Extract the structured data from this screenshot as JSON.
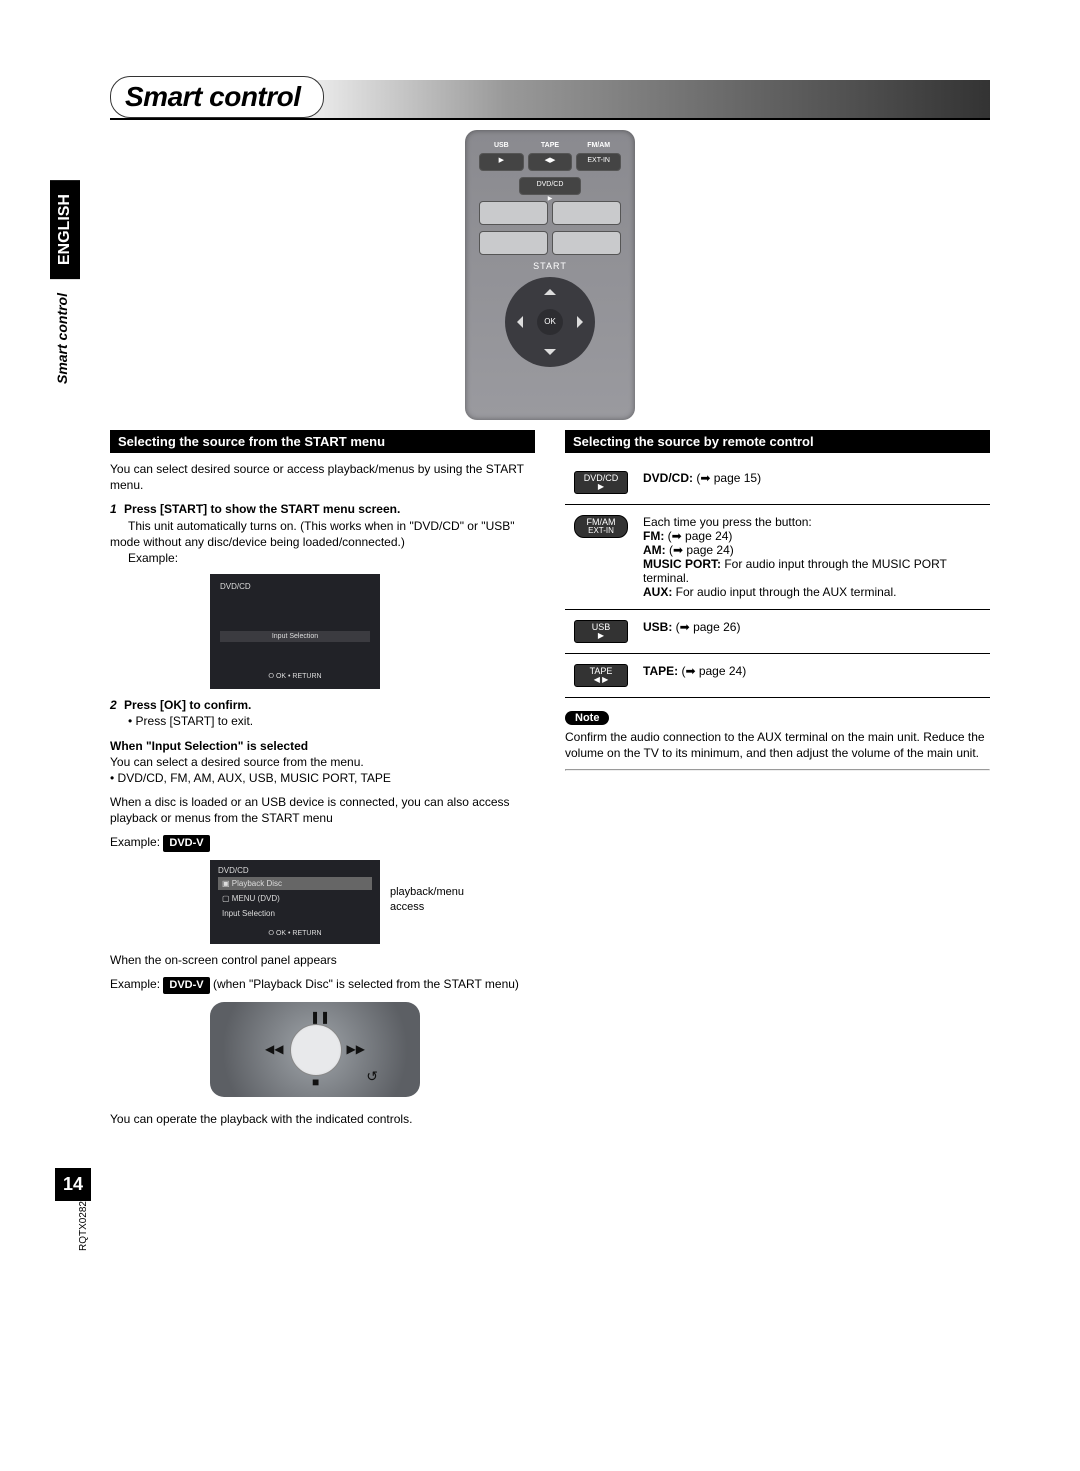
{
  "page": {
    "title": "Smart control",
    "language_tab": "ENGLISH",
    "side_label": "Smart control",
    "doc_code": "RQTX0282",
    "number": "14"
  },
  "remote": {
    "row1_labels": [
      "USB",
      "TAPE",
      "FM/AM"
    ],
    "row1_btn3": "EXT-IN",
    "dvdcd": "DVD/CD",
    "start": "START",
    "ok": "OK"
  },
  "left": {
    "header": "Selecting the source from the START menu",
    "intro": "You can select desired source or access playback/menus by using the START menu.",
    "step1_num": "1",
    "step1_head": "Press [START] to show the START menu screen.",
    "step1_body": "This unit automatically turns on. (This works when in \"DVD/CD\" or \"USB\" mode without any disc/device being loaded/connected.)",
    "example": "Example:",
    "screen1": {
      "title": "DVD/CD",
      "highlight": "Input Selection",
      "return": "OK • RETURN"
    },
    "step2_num": "2",
    "step2_head": "Press [OK] to confirm.",
    "step2_bullet": "Press [START] to exit.",
    "subhead": "When \"Input Selection\" is selected",
    "sub_body1": "You can select a desired source from the menu.",
    "sub_bullet": "DVD/CD, FM, AM, AUX, USB, MUSIC PORT, TAPE",
    "sub_body2": "When a disc is loaded or an USB device is connected, you can also access playback or menus from the START menu",
    "example2_label": "Example:",
    "example2_badge": "DVD-V",
    "screen2": {
      "title": "DVD/CD",
      "r1": "Playback Disc",
      "r2": "MENU (DVD)",
      "r3": "Input Selection",
      "return": "OK • RETURN"
    },
    "callout": "playback/menu access",
    "after1": "When the on-screen control panel appears",
    "after2_label": "Example:",
    "after2_badge": "DVD-V",
    "after2_tail": "(when \"Playback Disc\" is selected from the START menu)",
    "footer": "You can operate the playback with the indicated controls."
  },
  "right": {
    "header": "Selecting the source by remote control",
    "rows": [
      {
        "key": "DVD/CD",
        "key_sub": "▶",
        "shape": "rect",
        "text_bold": "DVD/CD:",
        "text": " (➡ page 15)"
      },
      {
        "key": "FM/AM",
        "key_sub": "EXT-IN",
        "shape": "oval",
        "lead": "Each time you press the button:",
        "lines": [
          {
            "b": "FM:",
            "t": " (➡ page 24)"
          },
          {
            "b": "AM:",
            "t": " (➡ page 24)"
          },
          {
            "b": "MUSIC PORT:",
            "t": "  For audio input through the MUSIC PORT terminal."
          },
          {
            "b": "AUX:",
            "t": " For audio input through the AUX terminal."
          }
        ]
      },
      {
        "key": "USB",
        "key_sub": "▶",
        "shape": "rect",
        "text_bold": "USB:",
        "text": " (➡ page 26)"
      },
      {
        "key": "TAPE",
        "key_sub": "◀ ▶",
        "shape": "rect",
        "text_bold": "TAPE:",
        "text": " (➡ page 24)"
      }
    ],
    "note_label": "Note",
    "note_body": "Confirm the audio connection to the AUX terminal on the main unit. Reduce the volume on the TV to its minimum, and then adjust the volume of the main unit."
  }
}
